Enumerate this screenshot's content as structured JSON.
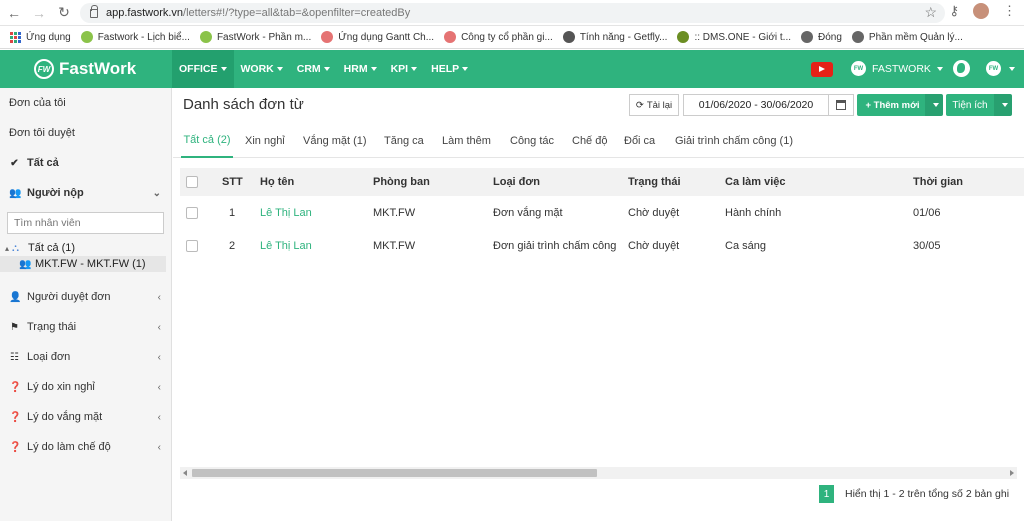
{
  "browser": {
    "url_host": "app.fastwork.vn",
    "url_path": "/letters#!/?type=all&tab=&openfilter=createdBy",
    "bookmarks": [
      {
        "label": "Ứng dụng",
        "color": "#d44"
      },
      {
        "label": "Fastwork - Lịch biể...",
        "color": "#8bc34a"
      },
      {
        "label": "FastWork - Phần m...",
        "color": "#8bc34a"
      },
      {
        "label": "Ứng dụng Gantt Ch...",
        "color": "#e57373"
      },
      {
        "label": "Công ty cổ phần gi...",
        "color": "#e57373"
      },
      {
        "label": "Tính năng - Getfly...",
        "color": "#555"
      },
      {
        "label": ":: DMS.ONE - Giới t...",
        "color": "#6b8e23"
      },
      {
        "label": "Đóng",
        "color": "#666"
      },
      {
        "label": "Phần mềm Quản lý...",
        "color": "#666"
      }
    ]
  },
  "app": {
    "brand": "FastWork",
    "logo_text": "FW",
    "accent": "#2fb37e",
    "menu": [
      "OFFICE",
      "WORK",
      "CRM",
      "HRM",
      "KPI",
      "HELP"
    ],
    "user_label": "FASTWORK"
  },
  "sidebar": {
    "top_items": [
      "Đơn của tôi",
      "Đơn tôi duyệt",
      "Tất cả",
      "Người nộp"
    ],
    "search_placeholder": "Tìm nhân viên",
    "tree_root": "Tất cả (1)",
    "tree_child": "MKT.FW - MKT.FW (1)",
    "filters": [
      "Người duyệt đơn",
      "Trạng thái",
      "Loại đơn",
      "Lý do xin nghỉ",
      "Lý do vắng mặt",
      "Lý do làm chế độ"
    ]
  },
  "main": {
    "title": "Danh sách đơn từ",
    "reload_label": "Tải lại",
    "date_range": "01/06/2020 - 30/06/2020",
    "new_label": "+ Thêm mới",
    "utility_label": "Tiện ích",
    "tabs": [
      "Tất cả (2)",
      "Xin nghỉ",
      "Vắng mặt (1)",
      "Tăng ca",
      "Làm thêm",
      "Công tác",
      "Chế độ",
      "Đổi ca",
      "Giải trình chấm công (1)"
    ],
    "columns": [
      "STT",
      "Họ tên",
      "Phòng ban",
      "Loại đơn",
      "Trạng thái",
      "Ca làm việc",
      "Thời gian"
    ],
    "rows": [
      {
        "stt": "1",
        "name": "Lê Thị Lan",
        "dept": "MKT.FW",
        "type": "Đơn vắng mặt",
        "status": "Chờ duyệt",
        "shift": "Hành chính",
        "time": "01/06"
      },
      {
        "stt": "2",
        "name": "Lê Thị Lan",
        "dept": "MKT.FW",
        "type": "Đơn giải trình chấm công",
        "status": "Chờ duyệt",
        "shift": "Ca sáng",
        "time": "30/05"
      }
    ],
    "page_current": "1",
    "page_info": "Hiển thị 1 - 2 trên tổng số 2 bản ghi"
  }
}
